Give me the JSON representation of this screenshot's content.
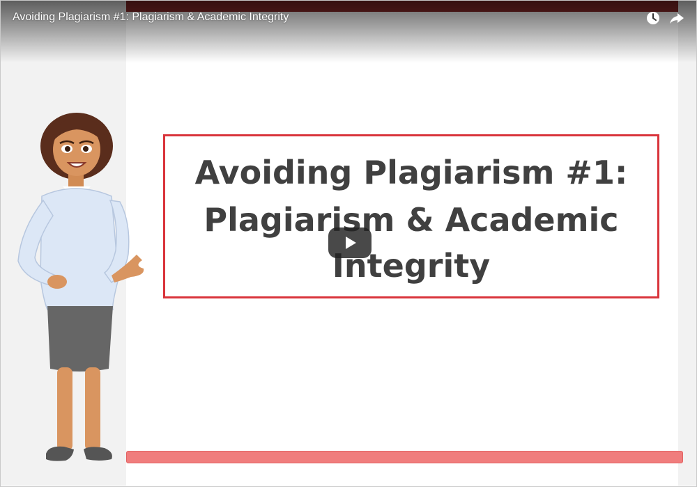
{
  "video": {
    "title": "Avoiding Plagiarism #1: Plagiarism & Academic Integrity"
  },
  "slide": {
    "lines": [
      "Avoiding Plagiarism #1:",
      "Plagiarism & Academic",
      "Integrity"
    ]
  },
  "controls": {
    "watch_later_icon": "clock-icon",
    "share_icon": "share-arrow-icon",
    "play_icon": "play-icon"
  },
  "colors": {
    "accent_border": "#d9343b",
    "bottom_bar": "#f07d7d",
    "top_stripe": "#8a2a2a",
    "slide_text": "#404040"
  }
}
